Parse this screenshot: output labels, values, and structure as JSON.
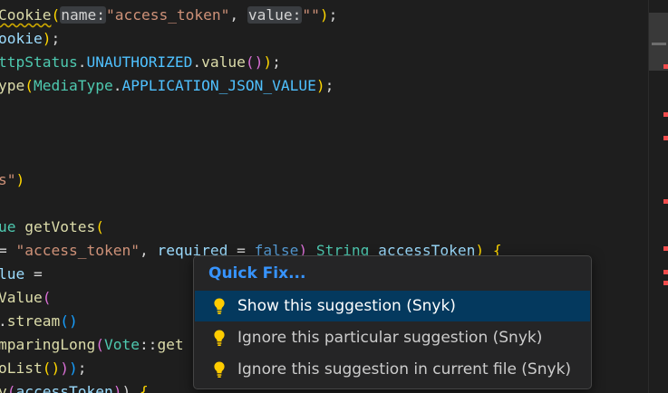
{
  "editor": {
    "lines": [
      {
        "segments": [
          {
            "text": "Cookie",
            "cls": "t-fn squiggle"
          },
          {
            "text": "(",
            "cls": "t-br1"
          },
          {
            "text": "name:",
            "cls": "hint"
          },
          {
            "text": "\"access_token\"",
            "cls": "t-str"
          },
          {
            "text": ", ",
            "cls": "t-plain"
          },
          {
            "text": "value:",
            "cls": "hint"
          },
          {
            "text": "\"\"",
            "cls": "t-str"
          },
          {
            "text": ")",
            "cls": "t-br1"
          },
          {
            "text": ";",
            "cls": "t-plain"
          }
        ]
      },
      {
        "segments": [
          {
            "text": "ookie",
            "cls": "t-param"
          },
          {
            "text": ")",
            "cls": "t-br1"
          },
          {
            "text": ";",
            "cls": "t-plain"
          }
        ]
      },
      {
        "segments": [
          {
            "text": "ttpStatus",
            "cls": "t-type"
          },
          {
            "text": ".",
            "cls": "t-plain"
          },
          {
            "text": "UNAUTHORIZED",
            "cls": "t-const"
          },
          {
            "text": ".",
            "cls": "t-plain"
          },
          {
            "text": "value",
            "cls": "t-fn"
          },
          {
            "text": "(",
            "cls": "t-br2"
          },
          {
            "text": ")",
            "cls": "t-br2"
          },
          {
            "text": ")",
            "cls": "t-br1"
          },
          {
            "text": ";",
            "cls": "t-plain"
          }
        ]
      },
      {
        "segments": [
          {
            "text": "ype",
            "cls": "t-fn"
          },
          {
            "text": "(",
            "cls": "t-br1"
          },
          {
            "text": "MediaType",
            "cls": "t-type"
          },
          {
            "text": ".",
            "cls": "t-plain"
          },
          {
            "text": "APPLICATION_JSON_VALUE",
            "cls": "t-const"
          },
          {
            "text": ")",
            "cls": "t-br1"
          },
          {
            "text": ";",
            "cls": "t-plain"
          }
        ]
      },
      {
        "segments": []
      },
      {
        "segments": []
      },
      {
        "segments": []
      },
      {
        "segments": [
          {
            "text": "s\"",
            "cls": "t-str"
          },
          {
            "text": ")",
            "cls": "t-br1"
          }
        ]
      },
      {
        "segments": []
      },
      {
        "segments": [
          {
            "text": "ue ",
            "cls": "t-type"
          },
          {
            "text": "getVotes",
            "cls": "t-fn"
          },
          {
            "text": "(",
            "cls": "t-br1"
          }
        ]
      },
      {
        "segments": [
          {
            "text": "= ",
            "cls": "t-plain"
          },
          {
            "text": "\"access_token\"",
            "cls": "t-str"
          },
          {
            "text": ", ",
            "cls": "t-plain"
          },
          {
            "text": "required",
            "cls": "t-param"
          },
          {
            "text": " = ",
            "cls": "t-plain"
          },
          {
            "text": "false",
            "cls": "t-kw"
          },
          {
            "text": ") ",
            "cls": "t-br2"
          },
          {
            "text": "String",
            "cls": "t-type"
          },
          {
            "text": " ",
            "cls": "t-plain"
          },
          {
            "text": "accessToken",
            "cls": "t-param"
          },
          {
            "text": ") ",
            "cls": "t-br1"
          },
          {
            "text": "{",
            "cls": "t-br1"
          }
        ]
      },
      {
        "segments": [
          {
            "text": "lue",
            "cls": "t-param"
          },
          {
            "text": " =",
            "cls": "t-plain"
          }
        ]
      },
      {
        "segments": [
          {
            "text": "Value",
            "cls": "t-fn"
          },
          {
            "text": "(",
            "cls": "t-br2"
          }
        ]
      },
      {
        "segments": [
          {
            "text": ".",
            "cls": "t-plain"
          },
          {
            "text": "stream",
            "cls": "t-fn"
          },
          {
            "text": "()",
            "cls": "t-br3"
          }
        ]
      },
      {
        "segments": [
          {
            "text": "mparingLong",
            "cls": "t-fn"
          },
          {
            "text": "(",
            "cls": "t-br2"
          },
          {
            "text": "Vote",
            "cls": "t-type"
          },
          {
            "text": "::",
            "cls": "t-plain"
          },
          {
            "text": "get",
            "cls": "t-fn"
          }
        ]
      },
      {
        "segments": [
          {
            "text": "oList",
            "cls": "t-fn"
          },
          {
            "text": "()",
            "cls": "t-br1"
          },
          {
            "text": ")",
            "cls": "t-br2"
          },
          {
            "text": ")",
            "cls": "t-br3"
          },
          {
            "text": ";",
            "cls": "t-plain"
          }
        ]
      },
      {
        "segments": [
          {
            "text": "y",
            "cls": "t-fn"
          },
          {
            "text": "(",
            "cls": "t-br2"
          },
          {
            "text": "accessToken",
            "cls": "t-param"
          },
          {
            "text": ")",
            "cls": "t-br2"
          },
          {
            "text": ") ",
            "cls": "t-plain"
          },
          {
            "text": "{",
            "cls": "t-br1"
          }
        ]
      }
    ]
  },
  "quick_fix": {
    "title": "Quick Fix...",
    "items": [
      {
        "label": "Show this suggestion (Snyk)",
        "icon": "lightbulb-icon",
        "selected": true
      },
      {
        "label": "Ignore this particular suggestion (Snyk)",
        "icon": "lightbulb-icon",
        "selected": false
      },
      {
        "label": "Ignore this suggestion in current file (Snyk)",
        "icon": "lightbulb-icon",
        "selected": false
      }
    ]
  },
  "colors": {
    "background": "#1e1e1e",
    "popup_background": "#252526",
    "selection": "#04395e",
    "accent": "#3794ff",
    "lightbulb": "#ffcc00",
    "error_marker": "#f14c4c"
  }
}
